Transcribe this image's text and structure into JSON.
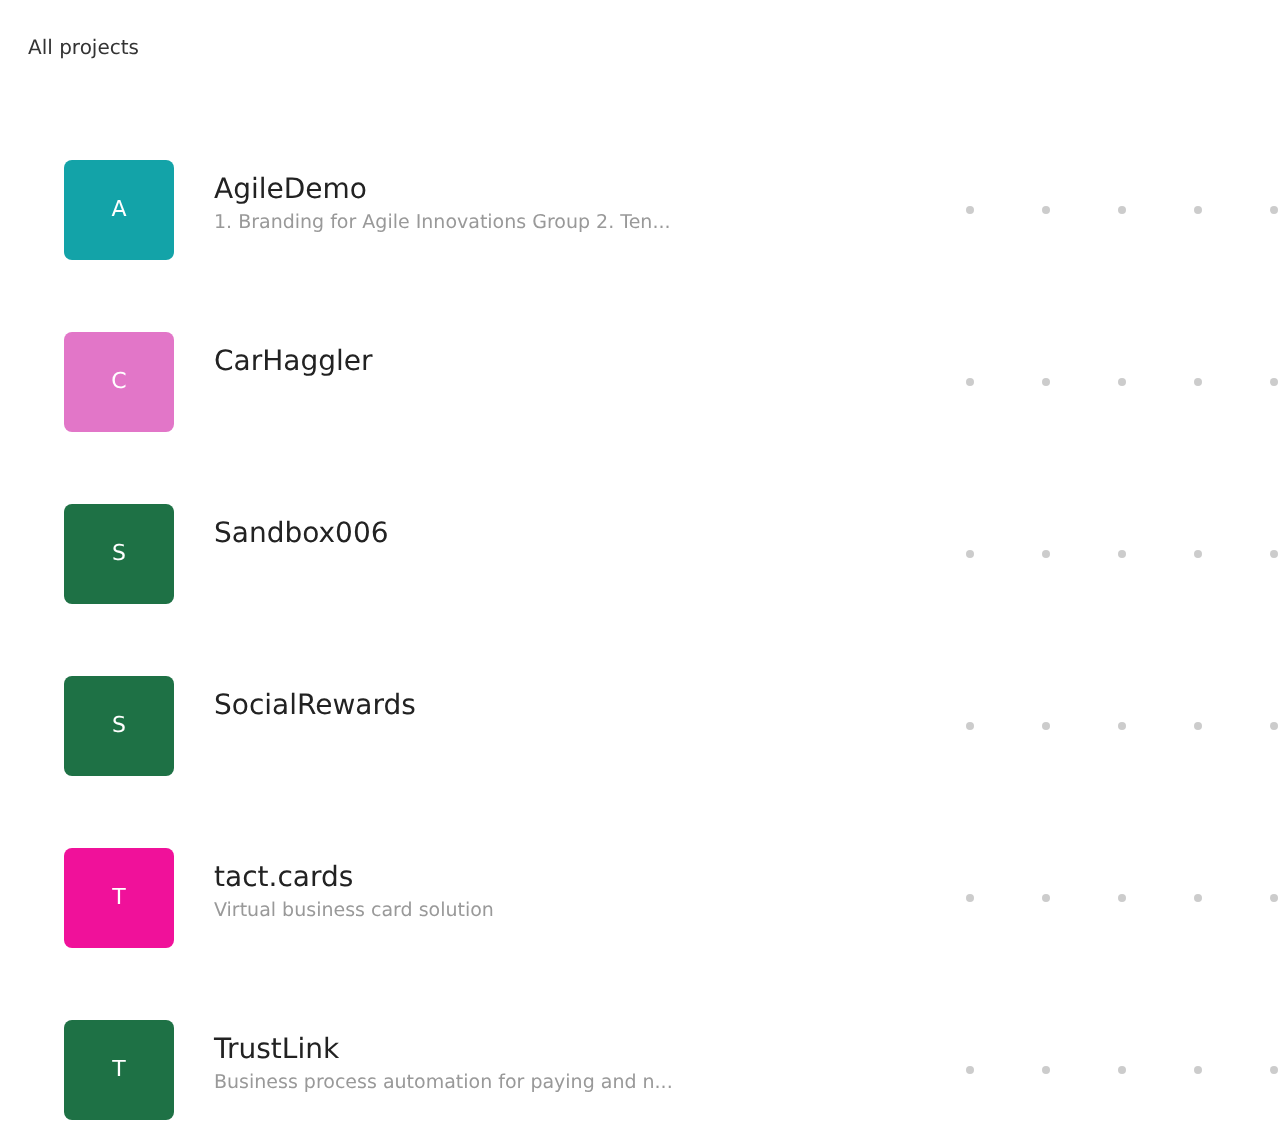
{
  "heading": "All projects",
  "projects": [
    {
      "initial": "A",
      "color": "#13a3a8",
      "name": "AgileDemo",
      "description": "1. Branding for Agile Innovations Group 2. Ten..."
    },
    {
      "initial": "C",
      "color": "#e276c8",
      "name": "CarHaggler"
    },
    {
      "initial": "S",
      "color": "#1e7145",
      "name": "Sandbox006"
    },
    {
      "initial": "S",
      "color": "#1e7145",
      "name": "SocialRewards"
    },
    {
      "initial": "T",
      "color": "#f0119a",
      "name": "tact.cards",
      "description": "Virtual business card solution"
    },
    {
      "initial": "T",
      "color": "#1e7145",
      "name": "TrustLink",
      "description": "Business process automation for paying and n..."
    }
  ]
}
